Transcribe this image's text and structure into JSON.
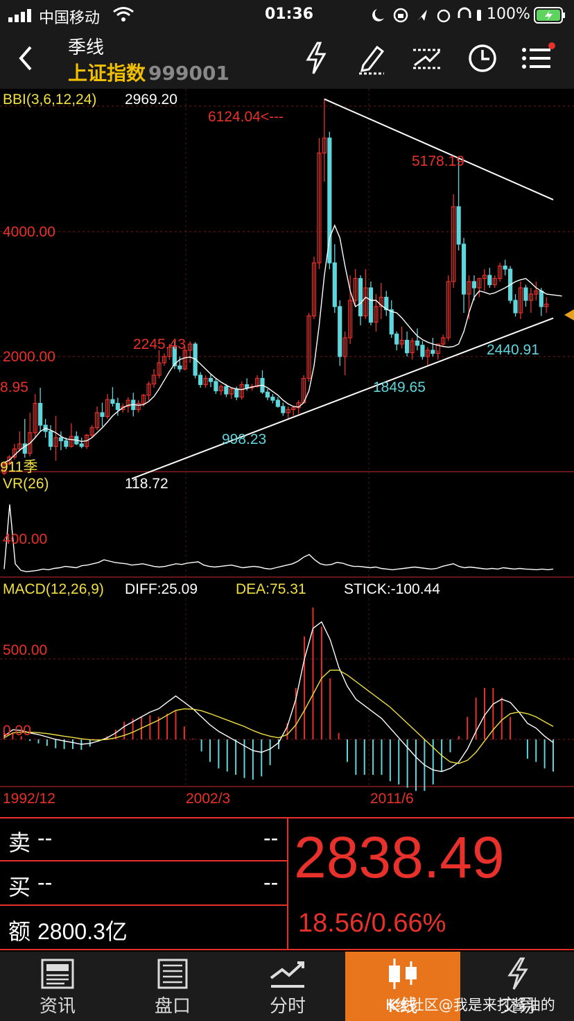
{
  "status_bar": {
    "carrier": "中国移动",
    "time": "01:36",
    "battery": "100%"
  },
  "header": {
    "period": "季线",
    "index_name": "上证指数",
    "code": "999001"
  },
  "nav_icons": [
    "flash-icon",
    "draw-pen-icon",
    "trend-line-icon",
    "clock-icon",
    "menu-icon"
  ],
  "indicators": {
    "bbi": {
      "label": "BBI(3,6,12,24)",
      "value": "2969.20"
    },
    "vr": {
      "label": "VR(26)",
      "value": "118.72",
      "axis": "400.00"
    },
    "macd": {
      "label": "MACD(12,26,9)",
      "diff": "DIFF:25.09",
      "dea": "DEA:75.31",
      "stick": "STICK:-100.44",
      "axis_hi": "500.00",
      "axis_zero": "0.00"
    }
  },
  "annotations": {
    "high1": "6124.04<---",
    "high2": "5178.19",
    "high3": "2245.43",
    "low1": "998.23",
    "low2": "1849.65",
    "low3": "2440.91",
    "left_value": "8.95",
    "left_marker": "911季",
    "axis_4000": "4000.00",
    "axis_2000": "2000.00"
  },
  "x_labels": [
    "1992/12",
    "2002/3",
    "2011/6"
  ],
  "quote": {
    "sell_label": "卖",
    "sell_value": "--",
    "sell_right": "--",
    "buy_label": "买",
    "buy_value": "--",
    "buy_right": "--",
    "amount_label": "额",
    "amount_value": "2800.3亿",
    "price": "2838.49",
    "change": "18.56/0.66%"
  },
  "tabs": [
    {
      "label": "资讯"
    },
    {
      "label": "盘口"
    },
    {
      "label": "分时"
    },
    {
      "label": "K线"
    },
    {
      "label": "交易"
    }
  ],
  "watermark": "K线社区@我是来打酱油的",
  "colors": {
    "up": "#e8312a",
    "down": "#5fd6dc",
    "bbi": "#ffffff",
    "dea": "#f0e040",
    "accent": "#e8741c",
    "label_yellow": "#f0e040"
  },
  "chart_data": {
    "type": "candlestick",
    "period": "quarterly",
    "x_start": "1990/12",
    "ylim": [
      300,
      6300
    ],
    "price_axis": [
      4000,
      2000
    ],
    "quarters": [
      {
        "o": 130,
        "h": 300,
        "l": 100,
        "c": 280
      },
      {
        "o": 280,
        "h": 420,
        "l": 260,
        "c": 390
      },
      {
        "o": 390,
        "h": 600,
        "l": 350,
        "c": 520
      },
      {
        "o": 520,
        "h": 800,
        "l": 480,
        "c": 600
      },
      {
        "o": 600,
        "h": 1000,
        "l": 380,
        "c": 450
      },
      {
        "o": 450,
        "h": 1100,
        "l": 400,
        "c": 780
      },
      {
        "o": 780,
        "h": 1400,
        "l": 700,
        "c": 1250
      },
      {
        "o": 1250,
        "h": 1500,
        "l": 800,
        "c": 900
      },
      {
        "o": 900,
        "h": 1000,
        "l": 700,
        "c": 800
      },
      {
        "o": 800,
        "h": 900,
        "l": 500,
        "c": 560
      },
      {
        "o": 560,
        "h": 1050,
        "l": 330,
        "c": 700
      },
      {
        "o": 700,
        "h": 800,
        "l": 500,
        "c": 650
      },
      {
        "o": 650,
        "h": 700,
        "l": 520,
        "c": 560
      },
      {
        "o": 560,
        "h": 930,
        "l": 540,
        "c": 720
      },
      {
        "o": 720,
        "h": 800,
        "l": 580,
        "c": 600
      },
      {
        "o": 600,
        "h": 700,
        "l": 530,
        "c": 560
      },
      {
        "o": 560,
        "h": 760,
        "l": 520,
        "c": 740
      },
      {
        "o": 740,
        "h": 900,
        "l": 700,
        "c": 860
      },
      {
        "o": 860,
        "h": 1200,
        "l": 820,
        "c": 1100
      },
      {
        "o": 1100,
        "h": 1260,
        "l": 880,
        "c": 1040
      },
      {
        "o": 1040,
        "h": 1400,
        "l": 1000,
        "c": 1310
      },
      {
        "o": 1310,
        "h": 1510,
        "l": 1200,
        "c": 1250
      },
      {
        "o": 1250,
        "h": 1340,
        "l": 1050,
        "c": 1150
      },
      {
        "o": 1150,
        "h": 1250,
        "l": 1100,
        "c": 1200
      },
      {
        "o": 1200,
        "h": 1350,
        "l": 1100,
        "c": 1300
      },
      {
        "o": 1300,
        "h": 1420,
        "l": 1040,
        "c": 1150
      },
      {
        "o": 1150,
        "h": 1300,
        "l": 1100,
        "c": 1250
      },
      {
        "o": 1250,
        "h": 1400,
        "l": 1200,
        "c": 1380
      },
      {
        "o": 1380,
        "h": 1600,
        "l": 1300,
        "c": 1560
      },
      {
        "o": 1560,
        "h": 1800,
        "l": 1500,
        "c": 1700
      },
      {
        "o": 1700,
        "h": 2100,
        "l": 1650,
        "c": 1900
      },
      {
        "o": 1900,
        "h": 2050,
        "l": 1850,
        "c": 2000
      },
      {
        "o": 2000,
        "h": 2200,
        "l": 1950,
        "c": 2150
      },
      {
        "o": 2150,
        "h": 2245,
        "l": 1800,
        "c": 1850
      },
      {
        "o": 1850,
        "h": 2000,
        "l": 1750,
        "c": 1800
      },
      {
        "o": 1800,
        "h": 2150,
        "l": 1780,
        "c": 2100
      },
      {
        "o": 2100,
        "h": 2242,
        "l": 1900,
        "c": 2200
      },
      {
        "o": 2200,
        "h": 2230,
        "l": 1650,
        "c": 1700
      },
      {
        "o": 1700,
        "h": 1750,
        "l": 1500,
        "c": 1550
      },
      {
        "o": 1550,
        "h": 1700,
        "l": 1500,
        "c": 1650
      },
      {
        "o": 1650,
        "h": 1720,
        "l": 1510,
        "c": 1600
      },
      {
        "o": 1600,
        "h": 1650,
        "l": 1400,
        "c": 1450
      },
      {
        "o": 1450,
        "h": 1550,
        "l": 1380,
        "c": 1520
      },
      {
        "o": 1520,
        "h": 1560,
        "l": 1350,
        "c": 1400
      },
      {
        "o": 1400,
        "h": 1500,
        "l": 1320,
        "c": 1480
      },
      {
        "o": 1480,
        "h": 1520,
        "l": 1300,
        "c": 1350
      },
      {
        "o": 1350,
        "h": 1600,
        "l": 1310,
        "c": 1550
      },
      {
        "o": 1550,
        "h": 1650,
        "l": 1450,
        "c": 1500
      },
      {
        "o": 1500,
        "h": 1560,
        "l": 1450,
        "c": 1520
      },
      {
        "o": 1520,
        "h": 1700,
        "l": 1500,
        "c": 1650
      },
      {
        "o": 1650,
        "h": 1780,
        "l": 1400,
        "c": 1430
      },
      {
        "o": 1430,
        "h": 1480,
        "l": 1300,
        "c": 1350
      },
      {
        "o": 1350,
        "h": 1400,
        "l": 1250,
        "c": 1300
      },
      {
        "o": 1300,
        "h": 1350,
        "l": 1180,
        "c": 1200
      },
      {
        "o": 1200,
        "h": 1260,
        "l": 1050,
        "c": 1100
      },
      {
        "o": 1100,
        "h": 1200,
        "l": 998,
        "c": 1150
      },
      {
        "o": 1150,
        "h": 1200,
        "l": 1050,
        "c": 1180
      },
      {
        "o": 1180,
        "h": 1300,
        "l": 1080,
        "c": 1260
      },
      {
        "o": 1260,
        "h": 1700,
        "l": 1250,
        "c": 1650
      },
      {
        "o": 1650,
        "h": 2700,
        "l": 1600,
        "c": 2650
      },
      {
        "o": 2650,
        "h": 3600,
        "l": 2600,
        "c": 3500
      },
      {
        "o": 3500,
        "h": 5500,
        "l": 3400,
        "c": 5260
      },
      {
        "o": 5260,
        "h": 6124,
        "l": 4800,
        "c": 5500
      },
      {
        "o": 5500,
        "h": 5600,
        "l": 3400,
        "c": 3500
      },
      {
        "o": 3500,
        "h": 3800,
        "l": 2700,
        "c": 2800
      },
      {
        "o": 2800,
        "h": 2900,
        "l": 1850,
        "c": 2000
      },
      {
        "o": 2000,
        "h": 2400,
        "l": 1700,
        "c": 2300
      },
      {
        "o": 2300,
        "h": 3300,
        "l": 2200,
        "c": 2900
      },
      {
        "o": 2900,
        "h": 3400,
        "l": 2800,
        "c": 3250
      },
      {
        "o": 3250,
        "h": 3300,
        "l": 2500,
        "c": 2650
      },
      {
        "o": 2650,
        "h": 3400,
        "l": 2600,
        "c": 3100
      },
      {
        "o": 3100,
        "h": 3200,
        "l": 2500,
        "c": 2550
      },
      {
        "o": 2550,
        "h": 3000,
        "l": 2400,
        "c": 2800
      },
      {
        "o": 2800,
        "h": 3180,
        "l": 2600,
        "c": 2950
      },
      {
        "o": 2950,
        "h": 3050,
        "l": 2650,
        "c": 2750
      },
      {
        "o": 2750,
        "h": 2900,
        "l": 2300,
        "c": 2360
      },
      {
        "o": 2360,
        "h": 2400,
        "l": 2100,
        "c": 2200
      },
      {
        "o": 2200,
        "h": 2480,
        "l": 2130,
        "c": 2260
      },
      {
        "o": 2260,
        "h": 2400,
        "l": 2000,
        "c": 2060
      },
      {
        "o": 2060,
        "h": 2300,
        "l": 1950,
        "c": 2250
      },
      {
        "o": 2250,
        "h": 2450,
        "l": 2100,
        "c": 2180
      },
      {
        "o": 2180,
        "h": 2250,
        "l": 1950,
        "c": 2000
      },
      {
        "o": 2000,
        "h": 2150,
        "l": 1849,
        "c": 2100
      },
      {
        "o": 2100,
        "h": 2300,
        "l": 2000,
        "c": 2050
      },
      {
        "o": 2050,
        "h": 2100,
        "l": 1950,
        "c": 2200
      },
      {
        "o": 2200,
        "h": 2350,
        "l": 2150,
        "c": 2300
      },
      {
        "o": 2300,
        "h": 3300,
        "l": 2250,
        "c": 3200
      },
      {
        "o": 3200,
        "h": 4600,
        "l": 3100,
        "c": 4400
      },
      {
        "o": 4400,
        "h": 5178,
        "l": 3700,
        "c": 3800
      },
      {
        "o": 3800,
        "h": 3900,
        "l": 2700,
        "c": 3000
      },
      {
        "o": 3000,
        "h": 3300,
        "l": 2600,
        "c": 3200
      },
      {
        "o": 3200,
        "h": 3300,
        "l": 2900,
        "c": 3100
      },
      {
        "o": 3100,
        "h": 3260,
        "l": 2950,
        "c": 3250
      },
      {
        "o": 3250,
        "h": 3400,
        "l": 3050,
        "c": 3300
      },
      {
        "o": 3300,
        "h": 3420,
        "l": 3100,
        "c": 3150
      },
      {
        "o": 3150,
        "h": 3300,
        "l": 3100,
        "c": 3250
      },
      {
        "o": 3250,
        "h": 3500,
        "l": 3200,
        "c": 3450
      },
      {
        "o": 3450,
        "h": 3550,
        "l": 3300,
        "c": 3400
      },
      {
        "o": 3400,
        "h": 3450,
        "l": 2850,
        "c": 2900
      },
      {
        "o": 2900,
        "h": 3000,
        "l": 2640,
        "c": 2700
      },
      {
        "o": 2700,
        "h": 3200,
        "l": 2600,
        "c": 3100
      },
      {
        "o": 3100,
        "h": 3150,
        "l": 2800,
        "c": 2900
      },
      {
        "o": 2900,
        "h": 3100,
        "l": 2700,
        "c": 3000
      },
      {
        "o": 3000,
        "h": 3200,
        "l": 2900,
        "c": 3050
      },
      {
        "o": 3050,
        "h": 3100,
        "l": 2650,
        "c": 2800
      },
      {
        "o": 2800,
        "h": 2950,
        "l": 2700,
        "c": 2840
      }
    ],
    "bbi_line": [
      300,
      340,
      420,
      500,
      560,
      610,
      700,
      800,
      850,
      820,
      780,
      720,
      680,
      670,
      660,
      640,
      650,
      700,
      780,
      860,
      950,
      1050,
      1120,
      1180,
      1220,
      1230,
      1220,
      1230,
      1280,
      1360,
      1480,
      1620,
      1760,
      1880,
      1950,
      1980,
      1990,
      1960,
      1880,
      1800,
      1720,
      1650,
      1590,
      1540,
      1500,
      1480,
      1470,
      1490,
      1510,
      1530,
      1540,
      1500,
      1440,
      1380,
      1300,
      1240,
      1200,
      1190,
      1260,
      1450,
      1850,
      2500,
      3300,
      3900,
      4100,
      3900,
      3450,
      3050,
      2800,
      2850,
      2950,
      2900,
      2900,
      2820,
      2760,
      2720,
      2700,
      2620,
      2520,
      2420,
      2330,
      2270,
      2230,
      2200,
      2180,
      2160,
      2150,
      2160,
      2200,
      2400,
      2700,
      2950,
      3050,
      3030,
      3000,
      3020,
      3060,
      3100,
      3150,
      3200,
      3230,
      3250,
      3180,
      3100,
      3050,
      3000,
      2990,
      2980,
      2969
    ],
    "vr_series": [
      40,
      530,
      80,
      30,
      20,
      25,
      30,
      40,
      35,
      45,
      50,
      60,
      55,
      50,
      65,
      70,
      80,
      90,
      110,
      100,
      90,
      85,
      80,
      70,
      75,
      80,
      70,
      60,
      55,
      60,
      70,
      80,
      75,
      85,
      90,
      95,
      70,
      60,
      55,
      60,
      65,
      70,
      60,
      50,
      55,
      60,
      55,
      45,
      40,
      50,
      60,
      70,
      80,
      100,
      130,
      150,
      110,
      80,
      70,
      75,
      90,
      85,
      70,
      60,
      60,
      55,
      50,
      55,
      45,
      40,
      35,
      40,
      45,
      50,
      55,
      50,
      45,
      40,
      45,
      60,
      70,
      80,
      60,
      50,
      55,
      50,
      45,
      40,
      45,
      40,
      50,
      45,
      40,
      45,
      40,
      38,
      35,
      40,
      35,
      40
    ],
    "macd": {
      "diff": [
        20,
        60,
        55,
        40,
        30,
        15,
        0,
        -10,
        -20,
        -30,
        -25,
        -10,
        10,
        40,
        80,
        110,
        140,
        170,
        190,
        230,
        270,
        230,
        190,
        140,
        90,
        50,
        20,
        -10,
        -40,
        -70,
        -80,
        -60,
        -20,
        80,
        250,
        500,
        690,
        730,
        620,
        450,
        330,
        250,
        210,
        170,
        130,
        70,
        10,
        -50,
        -110,
        -160,
        -190,
        -200,
        -180,
        -140,
        -60,
        50,
        150,
        220,
        250,
        230,
        170,
        100,
        70,
        20,
        -20
      ],
      "dea": [
        10,
        40,
        45,
        45,
        42,
        36,
        28,
        20,
        12,
        4,
        -2,
        -4,
        0,
        10,
        25,
        45,
        70,
        95,
        120,
        150,
        180,
        190,
        188,
        178,
        160,
        140,
        120,
        100,
        80,
        55,
        35,
        20,
        10,
        30,
        90,
        180,
        280,
        380,
        430,
        430,
        400,
        360,
        320,
        280,
        240,
        200,
        150,
        100,
        50,
        0,
        -50,
        -100,
        -140,
        -150,
        -130,
        -80,
        -10,
        60,
        120,
        160,
        170,
        160,
        140,
        110,
        80
      ],
      "stick": [
        40,
        40,
        20,
        -10,
        -25,
        -40,
        -55,
        -60,
        -60,
        -65,
        -45,
        -10,
        20,
        60,
        110,
        130,
        140,
        150,
        140,
        160,
        180,
        80,
        5,
        -75,
        -140,
        -180,
        -200,
        -220,
        -240,
        -250,
        -230,
        -160,
        -60,
        100,
        320,
        640,
        820,
        700,
        380,
        40,
        -140,
        -220,
        -220,
        -220,
        -220,
        -260,
        -280,
        -300,
        -320,
        -320,
        -280,
        -200,
        -80,
        20,
        140,
        260,
        320,
        320,
        260,
        140,
        0,
        -120,
        -140,
        -180,
        -200
      ]
    }
  }
}
